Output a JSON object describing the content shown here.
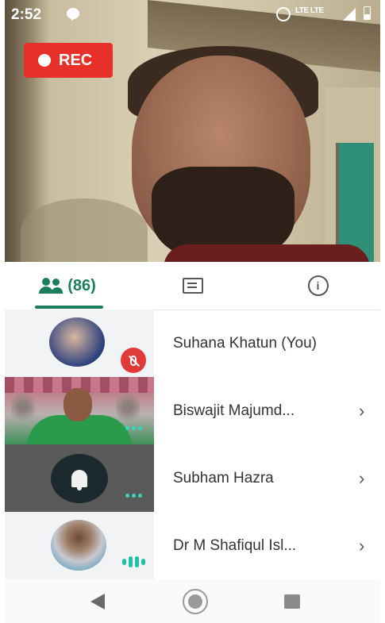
{
  "status_bar": {
    "time": "2:52",
    "network": "LTE LTE"
  },
  "recording": {
    "label": "REC"
  },
  "tabs": {
    "people_count": "(86)"
  },
  "participants": [
    {
      "name": "Suhana Khatun (You)",
      "status": "muted"
    },
    {
      "name": "Biswajit Majumd...",
      "status": "video-on"
    },
    {
      "name": "Subham Hazra",
      "status": "idle"
    },
    {
      "name": "Dr M Shafiqul Isl...",
      "status": "speaking"
    }
  ],
  "colors": {
    "accent": "#1a7f5a",
    "rec": "#e8302a",
    "muted": "#e03a3a",
    "indicator": "#38d6c0"
  }
}
